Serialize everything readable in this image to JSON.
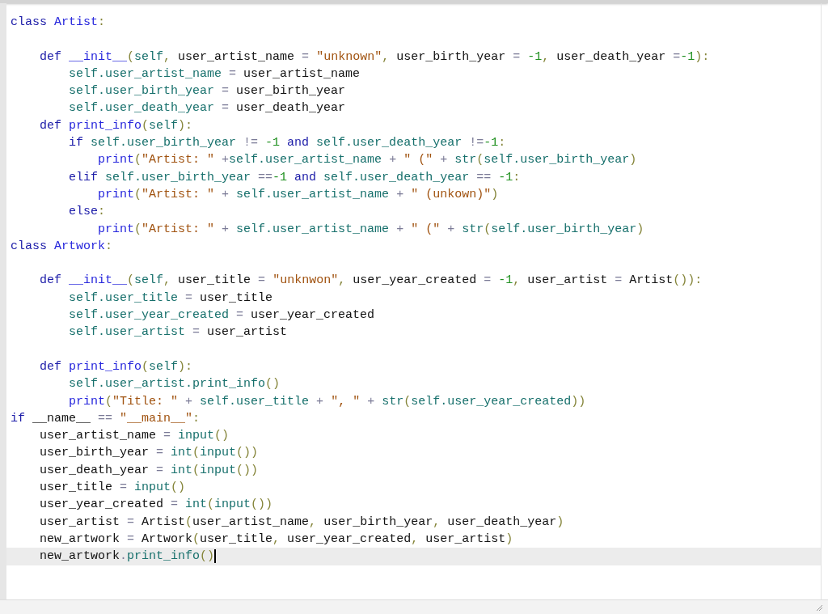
{
  "editor": {
    "lines": [
      {
        "current": false,
        "tokens": [
          {
            "kind": "keyword",
            "text": "class "
          },
          {
            "kind": "name",
            "text": "Artist"
          },
          {
            "kind": "punct",
            "text": ":"
          }
        ]
      },
      {
        "current": false
      },
      {
        "current": false,
        "tokens": [
          {
            "kind": "keyword",
            "text": "    def "
          },
          {
            "kind": "name",
            "text": "__init__"
          },
          {
            "kind": "punct",
            "text": "("
          },
          {
            "kind": "attr",
            "text": "self"
          },
          {
            "kind": "punct",
            "text": ", "
          },
          {
            "kind": "plain",
            "text": "user_artist_name "
          },
          {
            "kind": "op",
            "text": "= "
          },
          {
            "kind": "string",
            "text": "\"unknown\""
          },
          {
            "kind": "punct",
            "text": ", "
          },
          {
            "kind": "plain",
            "text": "user_birth_year "
          },
          {
            "kind": "op",
            "text": "= "
          },
          {
            "kind": "number",
            "text": "-1"
          },
          {
            "kind": "punct",
            "text": ", "
          },
          {
            "kind": "plain",
            "text": "user_death_year "
          },
          {
            "kind": "op",
            "text": "="
          },
          {
            "kind": "number",
            "text": "-1"
          },
          {
            "kind": "punct",
            "text": "):"
          }
        ]
      },
      {
        "current": false,
        "tokens": [
          {
            "kind": "attr",
            "text": "        self.user_artist_name "
          },
          {
            "kind": "op",
            "text": "= "
          },
          {
            "kind": "plain",
            "text": "user_artist_name"
          }
        ]
      },
      {
        "current": false,
        "tokens": [
          {
            "kind": "attr",
            "text": "        self.user_birth_year "
          },
          {
            "kind": "op",
            "text": "= "
          },
          {
            "kind": "plain",
            "text": "user_birth_year"
          }
        ]
      },
      {
        "current": false,
        "tokens": [
          {
            "kind": "attr",
            "text": "        self.user_death_year "
          },
          {
            "kind": "op",
            "text": "= "
          },
          {
            "kind": "plain",
            "text": "user_death_year"
          }
        ]
      },
      {
        "current": false,
        "tokens": [
          {
            "kind": "keyword",
            "text": "    def "
          },
          {
            "kind": "name",
            "text": "print_info"
          },
          {
            "kind": "punct",
            "text": "("
          },
          {
            "kind": "attr",
            "text": "self"
          },
          {
            "kind": "punct",
            "text": "):"
          }
        ]
      },
      {
        "current": false,
        "tokens": [
          {
            "kind": "keyword",
            "text": "        if "
          },
          {
            "kind": "attr",
            "text": "self.user_birth_year "
          },
          {
            "kind": "op",
            "text": "!= "
          },
          {
            "kind": "number",
            "text": "-1 "
          },
          {
            "kind": "keyword",
            "text": "and "
          },
          {
            "kind": "attr",
            "text": "self.user_death_year "
          },
          {
            "kind": "op",
            "text": "!="
          },
          {
            "kind": "number",
            "text": "-1"
          },
          {
            "kind": "punct",
            "text": ":"
          }
        ]
      },
      {
        "current": false,
        "tokens": [
          {
            "kind": "name",
            "text": "            print"
          },
          {
            "kind": "punct",
            "text": "("
          },
          {
            "kind": "string",
            "text": "\"Artist: \" "
          },
          {
            "kind": "op",
            "text": "+"
          },
          {
            "kind": "attr",
            "text": "self.user_artist_name "
          },
          {
            "kind": "op",
            "text": "+ "
          },
          {
            "kind": "string",
            "text": "\" (\" "
          },
          {
            "kind": "op",
            "text": "+ "
          },
          {
            "kind": "attr",
            "text": "str"
          },
          {
            "kind": "punct",
            "text": "("
          },
          {
            "kind": "attr",
            "text": "self.user_birth_year"
          },
          {
            "kind": "punct",
            "text": ")"
          }
        ]
      },
      {
        "current": false,
        "tokens": [
          {
            "kind": "keyword",
            "text": "        elif "
          },
          {
            "kind": "attr",
            "text": "self.user_birth_year "
          },
          {
            "kind": "op",
            "text": "=="
          },
          {
            "kind": "number",
            "text": "-1 "
          },
          {
            "kind": "keyword",
            "text": "and "
          },
          {
            "kind": "attr",
            "text": "self.user_death_year "
          },
          {
            "kind": "op",
            "text": "== "
          },
          {
            "kind": "number",
            "text": "-1"
          },
          {
            "kind": "punct",
            "text": ":"
          }
        ]
      },
      {
        "current": false,
        "tokens": [
          {
            "kind": "name",
            "text": "            print"
          },
          {
            "kind": "punct",
            "text": "("
          },
          {
            "kind": "string",
            "text": "\"Artist: \" "
          },
          {
            "kind": "op",
            "text": "+ "
          },
          {
            "kind": "attr",
            "text": "self.user_artist_name "
          },
          {
            "kind": "op",
            "text": "+ "
          },
          {
            "kind": "string",
            "text": "\" (unkown)\""
          },
          {
            "kind": "punct",
            "text": ")"
          }
        ]
      },
      {
        "current": false,
        "tokens": [
          {
            "kind": "keyword",
            "text": "        else"
          },
          {
            "kind": "punct",
            "text": ":"
          }
        ]
      },
      {
        "current": false,
        "tokens": [
          {
            "kind": "name",
            "text": "            print"
          },
          {
            "kind": "punct",
            "text": "("
          },
          {
            "kind": "string",
            "text": "\"Artist: \" "
          },
          {
            "kind": "op",
            "text": "+ "
          },
          {
            "kind": "attr",
            "text": "self.user_artist_name "
          },
          {
            "kind": "op",
            "text": "+ "
          },
          {
            "kind": "string",
            "text": "\" (\" "
          },
          {
            "kind": "op",
            "text": "+ "
          },
          {
            "kind": "attr",
            "text": "str"
          },
          {
            "kind": "punct",
            "text": "("
          },
          {
            "kind": "attr",
            "text": "self.user_birth_year"
          },
          {
            "kind": "punct",
            "text": ")"
          }
        ]
      },
      {
        "current": false,
        "tokens": [
          {
            "kind": "keyword",
            "text": "class "
          },
          {
            "kind": "name",
            "text": "Artwork"
          },
          {
            "kind": "punct",
            "text": ":"
          }
        ]
      },
      {
        "current": false
      },
      {
        "current": false,
        "tokens": [
          {
            "kind": "keyword",
            "text": "    def "
          },
          {
            "kind": "name",
            "text": "__init__"
          },
          {
            "kind": "punct",
            "text": "("
          },
          {
            "kind": "attr",
            "text": "self"
          },
          {
            "kind": "punct",
            "text": ", "
          },
          {
            "kind": "plain",
            "text": "user_title "
          },
          {
            "kind": "op",
            "text": "= "
          },
          {
            "kind": "string",
            "text": "\"unknwon\""
          },
          {
            "kind": "punct",
            "text": ", "
          },
          {
            "kind": "plain",
            "text": "user_year_created "
          },
          {
            "kind": "op",
            "text": "= "
          },
          {
            "kind": "number",
            "text": "-1"
          },
          {
            "kind": "punct",
            "text": ", "
          },
          {
            "kind": "plain",
            "text": "user_artist "
          },
          {
            "kind": "op",
            "text": "= "
          },
          {
            "kind": "plain",
            "text": "Artist"
          },
          {
            "kind": "punct",
            "text": "()):"
          }
        ]
      },
      {
        "current": false,
        "tokens": [
          {
            "kind": "attr",
            "text": "        self.user_title "
          },
          {
            "kind": "op",
            "text": "= "
          },
          {
            "kind": "plain",
            "text": "user_title"
          }
        ]
      },
      {
        "current": false,
        "tokens": [
          {
            "kind": "attr",
            "text": "        self.user_year_created "
          },
          {
            "kind": "op",
            "text": "= "
          },
          {
            "kind": "plain",
            "text": "user_year_created"
          }
        ]
      },
      {
        "current": false,
        "tokens": [
          {
            "kind": "attr",
            "text": "        self.user_artist "
          },
          {
            "kind": "op",
            "text": "= "
          },
          {
            "kind": "plain",
            "text": "user_artist"
          }
        ]
      },
      {
        "current": false
      },
      {
        "current": false,
        "tokens": [
          {
            "kind": "keyword",
            "text": "    def "
          },
          {
            "kind": "name",
            "text": "print_info"
          },
          {
            "kind": "punct",
            "text": "("
          },
          {
            "kind": "attr",
            "text": "self"
          },
          {
            "kind": "punct",
            "text": "):"
          }
        ]
      },
      {
        "current": false,
        "tokens": [
          {
            "kind": "attr",
            "text": "        self.user_artist.print_info"
          },
          {
            "kind": "punct",
            "text": "()"
          }
        ]
      },
      {
        "current": false,
        "tokens": [
          {
            "kind": "name",
            "text": "        print"
          },
          {
            "kind": "punct",
            "text": "("
          },
          {
            "kind": "string",
            "text": "\"Title: \" "
          },
          {
            "kind": "op",
            "text": "+ "
          },
          {
            "kind": "attr",
            "text": "self.user_title "
          },
          {
            "kind": "op",
            "text": "+ "
          },
          {
            "kind": "string",
            "text": "\", \" "
          },
          {
            "kind": "op",
            "text": "+ "
          },
          {
            "kind": "attr",
            "text": "str"
          },
          {
            "kind": "punct",
            "text": "("
          },
          {
            "kind": "attr",
            "text": "self.user_year_created"
          },
          {
            "kind": "punct",
            "text": "))"
          }
        ]
      },
      {
        "current": false,
        "tokens": [
          {
            "kind": "keyword",
            "text": "if "
          },
          {
            "kind": "plain",
            "text": "__name__ "
          },
          {
            "kind": "op",
            "text": "== "
          },
          {
            "kind": "string",
            "text": "\"__main__\""
          },
          {
            "kind": "punct",
            "text": ":"
          }
        ]
      },
      {
        "current": false,
        "tokens": [
          {
            "kind": "plain",
            "text": "    user_artist_name "
          },
          {
            "kind": "op",
            "text": "= "
          },
          {
            "kind": "attr",
            "text": "input"
          },
          {
            "kind": "punct",
            "text": "()"
          }
        ]
      },
      {
        "current": false,
        "tokens": [
          {
            "kind": "plain",
            "text": "    user_birth_year "
          },
          {
            "kind": "op",
            "text": "= "
          },
          {
            "kind": "attr",
            "text": "int"
          },
          {
            "kind": "punct",
            "text": "("
          },
          {
            "kind": "attr",
            "text": "input"
          },
          {
            "kind": "punct",
            "text": "())"
          }
        ]
      },
      {
        "current": false,
        "tokens": [
          {
            "kind": "plain",
            "text": "    user_death_year "
          },
          {
            "kind": "op",
            "text": "= "
          },
          {
            "kind": "attr",
            "text": "int"
          },
          {
            "kind": "punct",
            "text": "("
          },
          {
            "kind": "attr",
            "text": "input"
          },
          {
            "kind": "punct",
            "text": "())"
          }
        ]
      },
      {
        "current": false,
        "tokens": [
          {
            "kind": "plain",
            "text": "    user_title "
          },
          {
            "kind": "op",
            "text": "= "
          },
          {
            "kind": "attr",
            "text": "input"
          },
          {
            "kind": "punct",
            "text": "()"
          }
        ]
      },
      {
        "current": false,
        "tokens": [
          {
            "kind": "plain",
            "text": "    user_year_created "
          },
          {
            "kind": "op",
            "text": "= "
          },
          {
            "kind": "attr",
            "text": "int"
          },
          {
            "kind": "punct",
            "text": "("
          },
          {
            "kind": "attr",
            "text": "input"
          },
          {
            "kind": "punct",
            "text": "())"
          }
        ]
      },
      {
        "current": false,
        "tokens": [
          {
            "kind": "plain",
            "text": "    user_artist "
          },
          {
            "kind": "op",
            "text": "= "
          },
          {
            "kind": "plain",
            "text": "Artist"
          },
          {
            "kind": "punct",
            "text": "("
          },
          {
            "kind": "plain",
            "text": "user_artist_name"
          },
          {
            "kind": "punct",
            "text": ", "
          },
          {
            "kind": "plain",
            "text": "user_birth_year"
          },
          {
            "kind": "punct",
            "text": ", "
          },
          {
            "kind": "plain",
            "text": "user_death_year"
          },
          {
            "kind": "punct",
            "text": ")"
          }
        ]
      },
      {
        "current": false,
        "tokens": [
          {
            "kind": "plain",
            "text": "    new_artwork "
          },
          {
            "kind": "op",
            "text": "= "
          },
          {
            "kind": "plain",
            "text": "Artwork"
          },
          {
            "kind": "punct",
            "text": "("
          },
          {
            "kind": "plain",
            "text": "user_title"
          },
          {
            "kind": "punct",
            "text": ", "
          },
          {
            "kind": "plain",
            "text": "user_year_created"
          },
          {
            "kind": "punct",
            "text": ", "
          },
          {
            "kind": "plain",
            "text": "user_artist"
          },
          {
            "kind": "punct",
            "text": ")"
          }
        ]
      },
      {
        "current": true,
        "tokens": [
          {
            "kind": "plain",
            "text": "    new_artwork"
          },
          {
            "kind": "op",
            "text": "."
          },
          {
            "kind": "attr",
            "text": "print_info"
          },
          {
            "kind": "punct",
            "text": "()"
          }
        ]
      }
    ]
  }
}
